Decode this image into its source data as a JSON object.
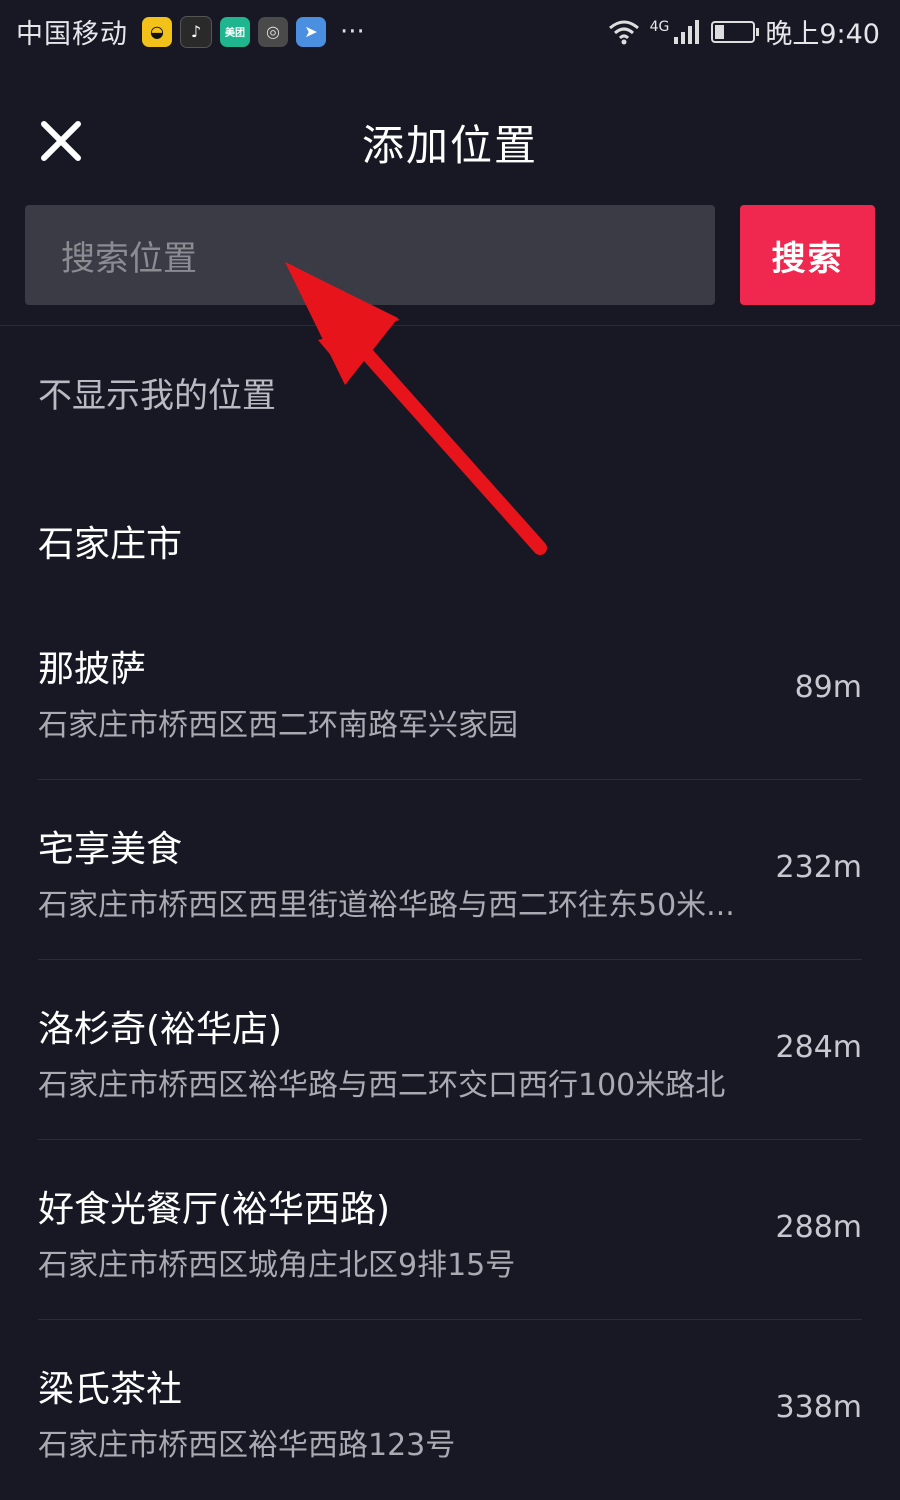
{
  "status_bar": {
    "carrier": "中国移动",
    "app_icons": [
      "map-app-icon",
      "tiktok-icon",
      "meituan-icon",
      "vpn-icon",
      "telegram-icon"
    ],
    "meituan_label": "美团",
    "more": "···",
    "network": "4G",
    "time": "晚上9:40"
  },
  "header": {
    "title": "添加位置"
  },
  "search": {
    "placeholder": "搜索位置",
    "button_label": "搜索"
  },
  "hide_location_label": "不显示我的位置",
  "city": "石家庄市",
  "places": [
    {
      "name": "那披萨",
      "address": "石家庄市桥西区西二环南路军兴家园",
      "distance": "89m"
    },
    {
      "name": "宅享美食",
      "address": "石家庄市桥西区西里街道裕华路与西二环往东50米...",
      "distance": "232m"
    },
    {
      "name": "洛杉奇(裕华店)",
      "address": "石家庄市桥西区裕华路与西二环交口西行100米路北",
      "distance": "284m"
    },
    {
      "name": "好食光餐厅(裕华西路)",
      "address": "石家庄市桥西区城角庄北区9排15号",
      "distance": "288m"
    },
    {
      "name": "梁氏茶社",
      "address": "石家庄市桥西区裕华西路123号",
      "distance": "338m"
    }
  ],
  "colors": {
    "background": "#171824",
    "search_button": "#f0284f",
    "arrow": "#e8141c"
  }
}
